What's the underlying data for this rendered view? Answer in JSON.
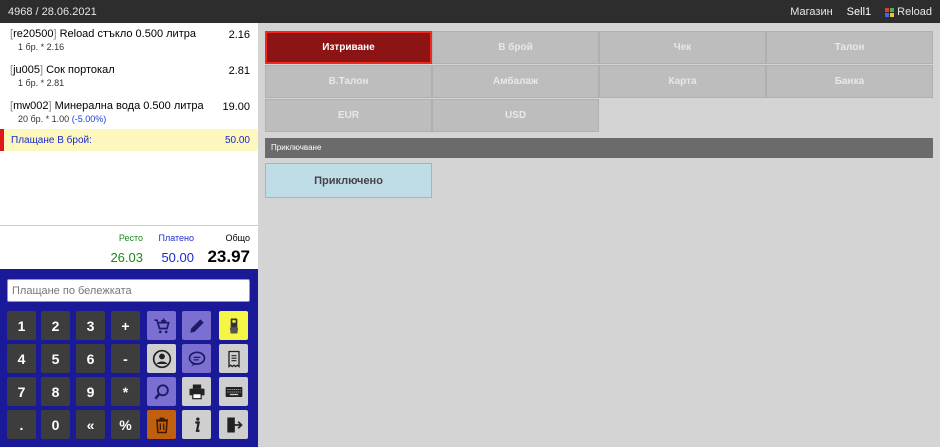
{
  "header": {
    "doc_info": "4968 / 28.06.2021",
    "store": "Магазин",
    "user": "Sell1",
    "reload": "Reload",
    "reload_colors": [
      "#e03b2f",
      "#4caf50",
      "#2f6fe0",
      "#f5c32c"
    ]
  },
  "lines": [
    {
      "code": "re20500",
      "name": "Reload стъкло 0.500 литра",
      "total": "2.16",
      "detail": "1 бр. * 2.16",
      "discount": ""
    },
    {
      "code": "ju005",
      "name": "Сок портокал",
      "total": "2.81",
      "detail": "1 бр. * 2.81",
      "discount": ""
    },
    {
      "code": "mw002",
      "name": "Минерална вода 0.500 литра",
      "total": "19.00",
      "detail": "20 бр. * 1.00",
      "discount": "(-5.00%)"
    }
  ],
  "payment": {
    "label": "Плащане В брой:",
    "amount": "50.00"
  },
  "totals": {
    "change_label": "Ресто",
    "change_value": "26.03",
    "paid_label": "Платено",
    "paid_value": "50.00",
    "total_label": "Общо",
    "total_value": "23.97"
  },
  "note_input": {
    "placeholder": "Плащане по бележката",
    "value": ""
  },
  "keys": [
    "1",
    "2",
    "3",
    "+",
    "4",
    "5",
    "6",
    "-",
    "7",
    "8",
    "9",
    "*",
    ".",
    "0",
    "«",
    "%"
  ],
  "action_icons": [
    "cart-icon",
    "pencil-icon",
    "scanner-hand-icon",
    "user-icon",
    "chat-icon",
    "receipt-icon",
    "search-icon",
    "printer-icon",
    "keyboard-icon",
    "trash-icon",
    "info-icon",
    "exit-icon"
  ],
  "payment_buttons": [
    "Изтриване",
    "В брой",
    "Чек",
    "Талон",
    "В.Талон",
    "Амбалаж",
    "Карта",
    "Банка",
    "EUR",
    "USD"
  ],
  "section": {
    "title": "Приключване"
  },
  "finish_button": "Приключено",
  "colors": {
    "active_button": "#8c1414",
    "keypad_bg": "#1a1a99",
    "payment_row": "#fdf6bd"
  }
}
